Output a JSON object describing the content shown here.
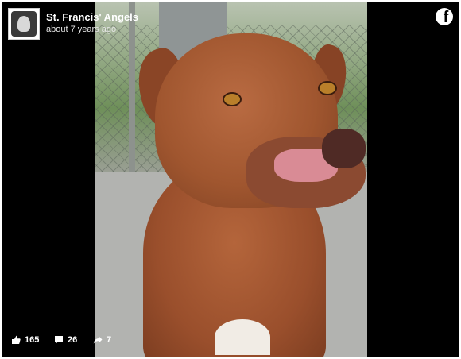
{
  "post": {
    "page_name": "St. Francis' Angels",
    "timestamp": "about 7 years ago",
    "avatar_icon": "angel-logo-icon",
    "platform_icon": "facebook-logo-icon"
  },
  "stats": {
    "likes": "165",
    "comments": "26",
    "shares": "7"
  },
  "colors": {
    "background": "#000000",
    "text": "#ffffff"
  }
}
